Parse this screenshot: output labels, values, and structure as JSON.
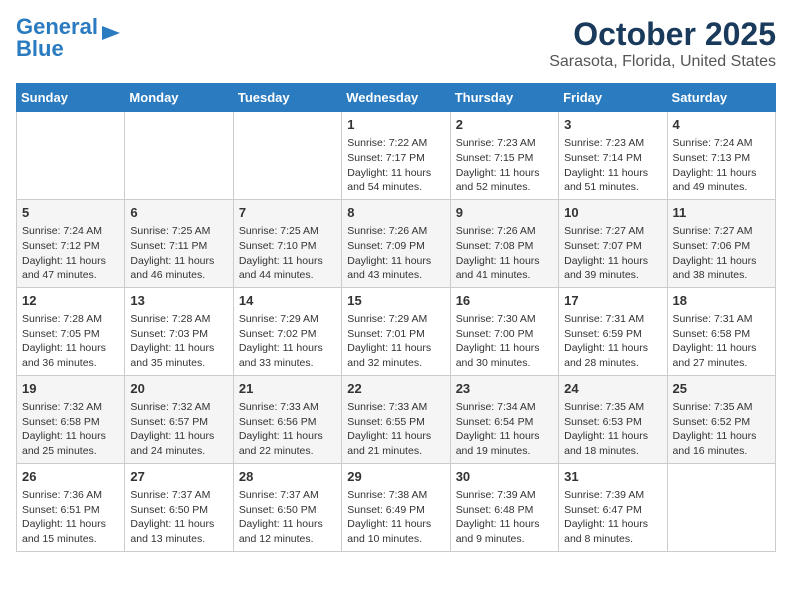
{
  "header": {
    "logo_line1": "General",
    "logo_line2": "Blue",
    "title": "October 2025",
    "subtitle": "Sarasota, Florida, United States"
  },
  "weekdays": [
    "Sunday",
    "Monday",
    "Tuesday",
    "Wednesday",
    "Thursday",
    "Friday",
    "Saturday"
  ],
  "weeks": [
    [
      {
        "day": "",
        "info": ""
      },
      {
        "day": "",
        "info": ""
      },
      {
        "day": "",
        "info": ""
      },
      {
        "day": "1",
        "info": "Sunrise: 7:22 AM\nSunset: 7:17 PM\nDaylight: 11 hours and 54 minutes."
      },
      {
        "day": "2",
        "info": "Sunrise: 7:23 AM\nSunset: 7:15 PM\nDaylight: 11 hours and 52 minutes."
      },
      {
        "day": "3",
        "info": "Sunrise: 7:23 AM\nSunset: 7:14 PM\nDaylight: 11 hours and 51 minutes."
      },
      {
        "day": "4",
        "info": "Sunrise: 7:24 AM\nSunset: 7:13 PM\nDaylight: 11 hours and 49 minutes."
      }
    ],
    [
      {
        "day": "5",
        "info": "Sunrise: 7:24 AM\nSunset: 7:12 PM\nDaylight: 11 hours and 47 minutes."
      },
      {
        "day": "6",
        "info": "Sunrise: 7:25 AM\nSunset: 7:11 PM\nDaylight: 11 hours and 46 minutes."
      },
      {
        "day": "7",
        "info": "Sunrise: 7:25 AM\nSunset: 7:10 PM\nDaylight: 11 hours and 44 minutes."
      },
      {
        "day": "8",
        "info": "Sunrise: 7:26 AM\nSunset: 7:09 PM\nDaylight: 11 hours and 43 minutes."
      },
      {
        "day": "9",
        "info": "Sunrise: 7:26 AM\nSunset: 7:08 PM\nDaylight: 11 hours and 41 minutes."
      },
      {
        "day": "10",
        "info": "Sunrise: 7:27 AM\nSunset: 7:07 PM\nDaylight: 11 hours and 39 minutes."
      },
      {
        "day": "11",
        "info": "Sunrise: 7:27 AM\nSunset: 7:06 PM\nDaylight: 11 hours and 38 minutes."
      }
    ],
    [
      {
        "day": "12",
        "info": "Sunrise: 7:28 AM\nSunset: 7:05 PM\nDaylight: 11 hours and 36 minutes."
      },
      {
        "day": "13",
        "info": "Sunrise: 7:28 AM\nSunset: 7:03 PM\nDaylight: 11 hours and 35 minutes."
      },
      {
        "day": "14",
        "info": "Sunrise: 7:29 AM\nSunset: 7:02 PM\nDaylight: 11 hours and 33 minutes."
      },
      {
        "day": "15",
        "info": "Sunrise: 7:29 AM\nSunset: 7:01 PM\nDaylight: 11 hours and 32 minutes."
      },
      {
        "day": "16",
        "info": "Sunrise: 7:30 AM\nSunset: 7:00 PM\nDaylight: 11 hours and 30 minutes."
      },
      {
        "day": "17",
        "info": "Sunrise: 7:31 AM\nSunset: 6:59 PM\nDaylight: 11 hours and 28 minutes."
      },
      {
        "day": "18",
        "info": "Sunrise: 7:31 AM\nSunset: 6:58 PM\nDaylight: 11 hours and 27 minutes."
      }
    ],
    [
      {
        "day": "19",
        "info": "Sunrise: 7:32 AM\nSunset: 6:58 PM\nDaylight: 11 hours and 25 minutes."
      },
      {
        "day": "20",
        "info": "Sunrise: 7:32 AM\nSunset: 6:57 PM\nDaylight: 11 hours and 24 minutes."
      },
      {
        "day": "21",
        "info": "Sunrise: 7:33 AM\nSunset: 6:56 PM\nDaylight: 11 hours and 22 minutes."
      },
      {
        "day": "22",
        "info": "Sunrise: 7:33 AM\nSunset: 6:55 PM\nDaylight: 11 hours and 21 minutes."
      },
      {
        "day": "23",
        "info": "Sunrise: 7:34 AM\nSunset: 6:54 PM\nDaylight: 11 hours and 19 minutes."
      },
      {
        "day": "24",
        "info": "Sunrise: 7:35 AM\nSunset: 6:53 PM\nDaylight: 11 hours and 18 minutes."
      },
      {
        "day": "25",
        "info": "Sunrise: 7:35 AM\nSunset: 6:52 PM\nDaylight: 11 hours and 16 minutes."
      }
    ],
    [
      {
        "day": "26",
        "info": "Sunrise: 7:36 AM\nSunset: 6:51 PM\nDaylight: 11 hours and 15 minutes."
      },
      {
        "day": "27",
        "info": "Sunrise: 7:37 AM\nSunset: 6:50 PM\nDaylight: 11 hours and 13 minutes."
      },
      {
        "day": "28",
        "info": "Sunrise: 7:37 AM\nSunset: 6:50 PM\nDaylight: 11 hours and 12 minutes."
      },
      {
        "day": "29",
        "info": "Sunrise: 7:38 AM\nSunset: 6:49 PM\nDaylight: 11 hours and 10 minutes."
      },
      {
        "day": "30",
        "info": "Sunrise: 7:39 AM\nSunset: 6:48 PM\nDaylight: 11 hours and 9 minutes."
      },
      {
        "day": "31",
        "info": "Sunrise: 7:39 AM\nSunset: 6:47 PM\nDaylight: 11 hours and 8 minutes."
      },
      {
        "day": "",
        "info": ""
      }
    ]
  ]
}
